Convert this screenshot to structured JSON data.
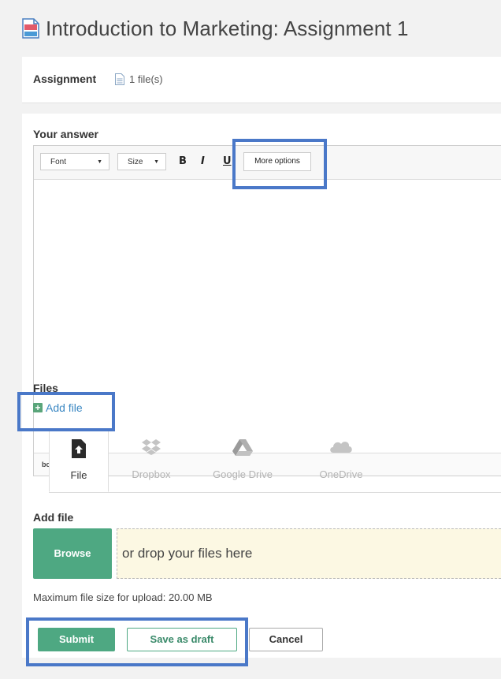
{
  "page": {
    "title": "Introduction to Marketing: Assignment 1"
  },
  "assignment": {
    "label": "Assignment",
    "files": "1 file(s)"
  },
  "answer": {
    "label": "Your answer",
    "toolbar": {
      "font": "Font",
      "size": "Size",
      "bold": "B",
      "italic": "I",
      "underline": "U",
      "more_options": "More options"
    },
    "status_path": "body  p"
  },
  "files": {
    "label": "Files",
    "add_file_link": "Add file",
    "tabs": [
      {
        "label": "File",
        "icon": "file-upload-icon",
        "active": true
      },
      {
        "label": "Dropbox",
        "icon": "dropbox-icon",
        "active": false
      },
      {
        "label": "Google Drive",
        "icon": "google-drive-icon",
        "active": false
      },
      {
        "label": "OneDrive",
        "icon": "onedrive-icon",
        "active": false
      }
    ],
    "add_file_heading": "Add file",
    "browse_label": "Browse",
    "drop_text": "or drop your files here",
    "max_size_text": "Maximum file size for upload: 20.00 MB"
  },
  "actions": {
    "submit": "Submit",
    "save_draft": "Save as draft",
    "cancel": "Cancel"
  },
  "colors": {
    "accent_green": "#4ea882",
    "link_blue": "#3b88c3",
    "highlight_blue": "#4a78c8",
    "drop_zone_bg": "#fcf8e3"
  }
}
